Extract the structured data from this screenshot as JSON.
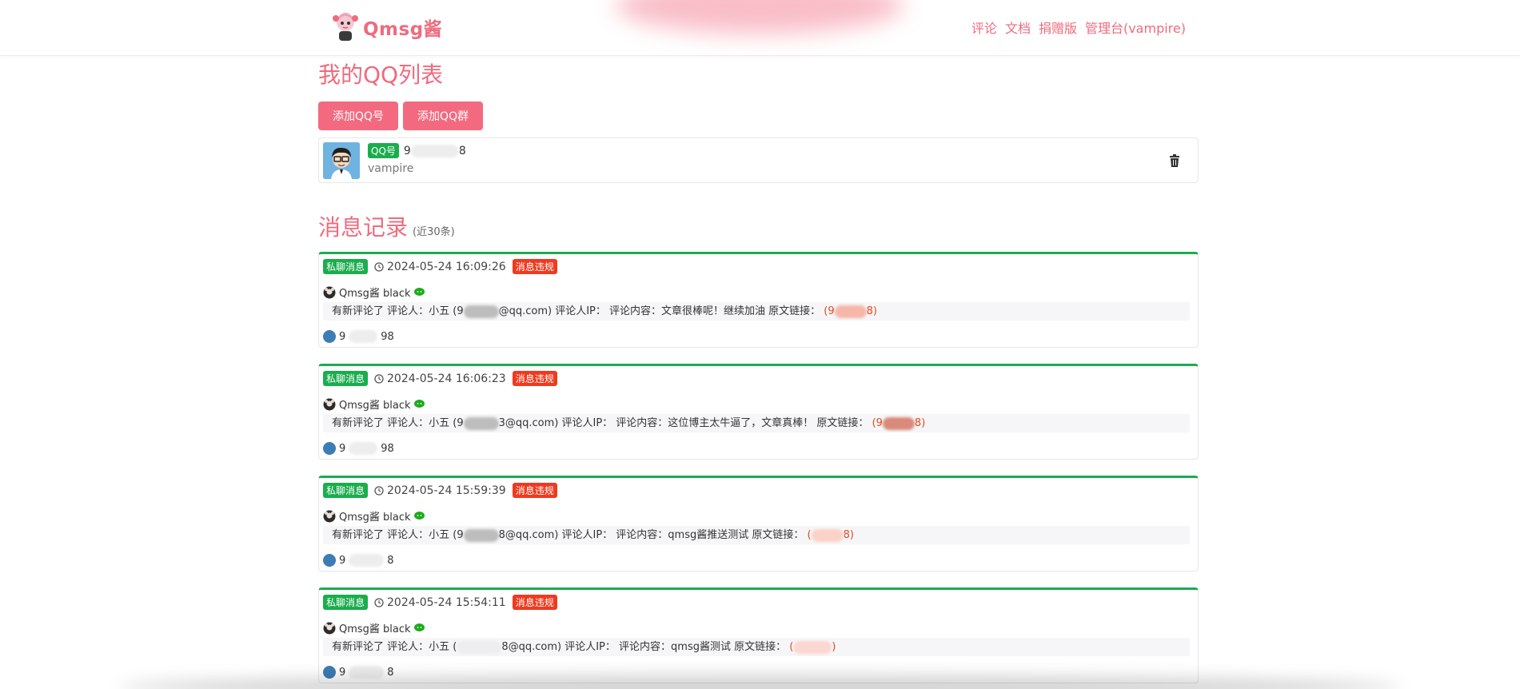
{
  "brand": {
    "name": "Qmsg酱"
  },
  "nav": {
    "items": [
      {
        "label": "评论"
      },
      {
        "label": "文档"
      },
      {
        "label": "捐赠版"
      },
      {
        "label": "管理台(vampire)"
      }
    ]
  },
  "qq_section": {
    "title": "我的QQ列表",
    "add_qq_label": "添加QQ号",
    "add_group_label": "添加QQ群",
    "item": {
      "badge": "QQ号",
      "number_start": "9",
      "number_end": "8",
      "nickname": "vampire"
    }
  },
  "msg_section": {
    "title": "消息记录",
    "subtitle": "(近30条)",
    "messages": [
      {
        "type": "私聊消息",
        "time": "2024-05-24 16:09:26",
        "status": "消息违规",
        "bot": "Qmsg酱 black",
        "content_prefix": "有新评论了 评论人：小五 (9",
        "content_mid": "@qq.com) 评论人IP： 评论内容：文章很棒呢！继续加油 原文链接：",
        "link_start": "(9",
        "link_end": "8)",
        "receiver_start": "9",
        "receiver_end": "98"
      },
      {
        "type": "私聊消息",
        "time": "2024-05-24 16:06:23",
        "status": "消息违规",
        "bot": "Qmsg酱 black",
        "content_prefix": "有新评论了 评论人：小五 (9",
        "content_mid": "3@qq.com) 评论人IP： 评论内容：这位博主太牛逼了，文章真棒！ 原文链接：",
        "link_start": "(9",
        "link_end": "8)",
        "receiver_start": "9",
        "receiver_end": "98"
      },
      {
        "type": "私聊消息",
        "time": "2024-05-24 15:59:39",
        "status": "消息违规",
        "bot": "Qmsg酱 black",
        "content_prefix": "有新评论了 评论人：小五 (9",
        "content_mid": "8@qq.com) 评论人IP： 评论内容：qmsg酱推送测试 原文链接：",
        "link_start": "(",
        "link_end": "8)",
        "receiver_start": "9",
        "receiver_end": "8"
      },
      {
        "type": "私聊消息",
        "time": "2024-05-24 15:54:11",
        "status": "消息违规",
        "bot": "Qmsg酱 black",
        "content_prefix": "有新评论了 评论人：小五 (",
        "content_mid": "8@qq.com) 评论人IP： 评论内容：qmsg酱测试 原文链接：",
        "link_start": "(",
        "link_end": ")",
        "receiver_start": "9",
        "receiver_end": "8"
      }
    ]
  },
  "colors": {
    "accent_pink": "#ef6b7e",
    "button_pink": "#f36a80",
    "badge_green": "#1aad4d",
    "badge_red": "#ee3b20",
    "link_orange": "#e8461c"
  }
}
